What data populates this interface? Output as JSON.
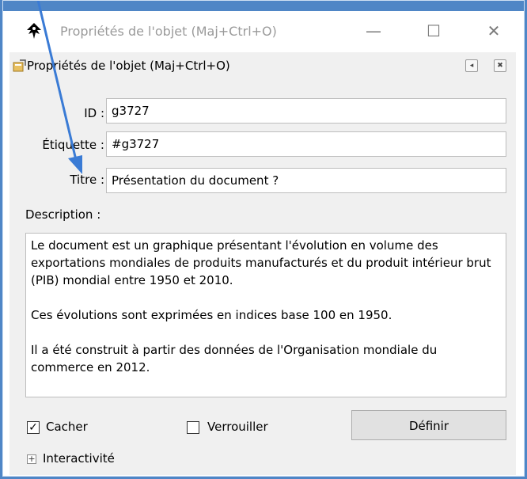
{
  "window": {
    "title": "Propriétés de l'objet (Maj+Ctrl+O)",
    "controls": {
      "minimize": "—",
      "maximize": "☐",
      "close": "✕"
    }
  },
  "dock": {
    "title": "Propriétés de l'objet (Maj+Ctrl+O)",
    "btn_a": "◂",
    "btn_b": "✖"
  },
  "form": {
    "id_label": "ID :",
    "id_value": "g3727",
    "label_label": "Étiquette :",
    "label_value": "#g3727",
    "title_label": "Titre :",
    "title_value": "Présentation du document ?",
    "description_label": "Description :",
    "description_value": "Le document est un graphique présentant l'évolution en volume des exportations mondiales de produits manufacturés et du produit intérieur brut (PIB) mondial entre 1950 et 2010.\n\nCes évolutions sont exprimées en indices base 100 en 1950.\n\nIl a été construit à partir des données de l'Organisation mondiale du commerce en 2012.",
    "hide_label": "Cacher",
    "hide_checked": true,
    "lock_label": "Verrouiller",
    "lock_checked": false,
    "set_button": "Définir",
    "interactivity_label": "Interactivité"
  },
  "colors": {
    "accent": "#4f86c6",
    "arrow": "#3a7bd5",
    "panel": "#f0f0f0"
  }
}
